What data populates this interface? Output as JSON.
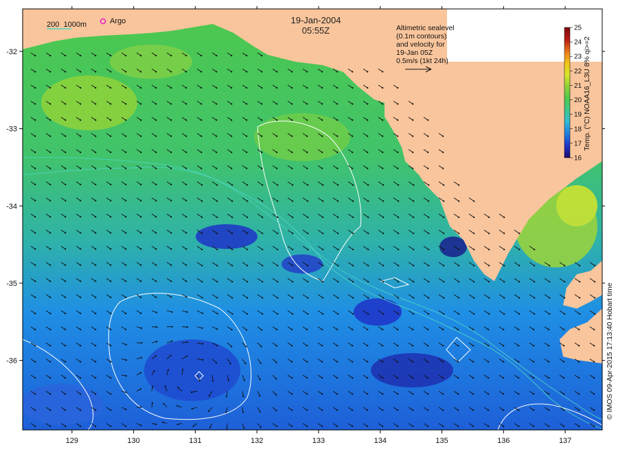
{
  "map": {
    "date": "19-Jan-2004",
    "time": "05:55Z",
    "lon_min": 128.2,
    "lon_max": 137.6,
    "lat_min": -36.9,
    "lat_max": -31.45,
    "x_ticks": [
      129,
      130,
      131,
      132,
      133,
      134,
      135,
      136,
      137
    ],
    "x_tick_labels": [
      "129",
      "130",
      "131",
      "132",
      "133",
      "134",
      "135",
      "136",
      "137"
    ],
    "y_ticks": [
      -32,
      -33,
      -34,
      -35,
      -36
    ],
    "y_tick_labels": [
      "-32",
      "-33",
      "-34",
      "-35",
      "-36"
    ],
    "land_color": "#f9c59c",
    "contour_color": "#ffffff"
  },
  "legend": {
    "isobath_label": "200  1000m",
    "argo_label": "Argo",
    "argo_color": "#ee22cc",
    "isobath_color": "#4cd6c4"
  },
  "annotation": {
    "lines": [
      "Altimetric sealevel",
      "(0.1m contours)",
      "and velocity for",
      "19-Jan 05Z",
      "0.5m/s (1kt 24h)"
    ]
  },
  "colorbar": {
    "label": "Temp. (°C) NOAA16_L3U 8% qi>=2",
    "min": 16,
    "max": 25,
    "ticks": [
      "25",
      "24",
      "23",
      "22",
      "21",
      "20",
      "19",
      "18",
      "17",
      "16"
    ],
    "colors": [
      "#1a0a6e",
      "#1f33c8",
      "#1f7ee0",
      "#33b9d6",
      "#41c68d",
      "#4ec84c",
      "#8fd23a",
      "#d6e62a",
      "#f2c419",
      "#e8741a",
      "#b81a12",
      "#7a0c0c"
    ]
  },
  "credit": "© IMOS 09-Apr-2015 17:13:40 Hobart time"
}
